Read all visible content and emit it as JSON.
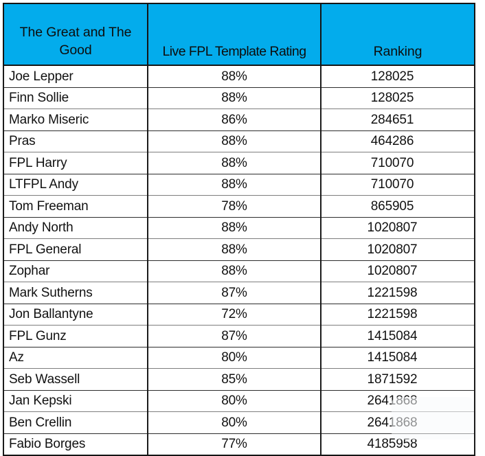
{
  "table": {
    "columns": [
      {
        "key": "name",
        "label": "The Great and The Good",
        "align": "left"
      },
      {
        "key": "rating",
        "label": "Live FPL Template Rating",
        "align": "center"
      },
      {
        "key": "rank",
        "label": "Ranking",
        "align": "center"
      }
    ],
    "header_background": "#03ACEC",
    "header_text_color": "#0d0d0d",
    "rows": [
      {
        "name": "Joe Lepper",
        "rating": "88%",
        "rank": "128025"
      },
      {
        "name": "Finn Sollie",
        "rating": "88%",
        "rank": "128025"
      },
      {
        "name": "Marko Miseric",
        "rating": "86%",
        "rank": "284651"
      },
      {
        "name": "Pras",
        "rating": "88%",
        "rank": "464286"
      },
      {
        "name": "FPL Harry",
        "rating": "88%",
        "rank": "710070"
      },
      {
        "name": "LTFPL Andy",
        "rating": "88%",
        "rank": "710070"
      },
      {
        "name": "Tom Freeman",
        "rating": "78%",
        "rank": "865905"
      },
      {
        "name": "Andy North",
        "rating": "88%",
        "rank": "1020807"
      },
      {
        "name": "FPL General",
        "rating": "88%",
        "rank": "1020807"
      },
      {
        "name": "Zophar",
        "rating": "88%",
        "rank": "1020807"
      },
      {
        "name": "Mark Sutherns",
        "rating": "87%",
        "rank": "1221598"
      },
      {
        "name": "Jon Ballantyne",
        "rating": "72%",
        "rank": "1221598"
      },
      {
        "name": "FPL Gunz",
        "rating": "87%",
        "rank": "1415084"
      },
      {
        "name": "Az",
        "rating": "80%",
        "rank": "1415084"
      },
      {
        "name": "Seb Wassell",
        "rating": "85%",
        "rank": "1871592"
      },
      {
        "name": "Jan Kepski",
        "rating": "80%",
        "rank": "2641868"
      },
      {
        "name": "Ben Crellin",
        "rating": "80%",
        "rank": "2641868"
      },
      {
        "name": "Fabio Borges",
        "rating": "77%",
        "rank": "4185958"
      }
    ]
  },
  "chart_data": {
    "type": "table",
    "title": "",
    "columns": [
      "The Great and The Good",
      "Live FPL Template Rating",
      "Ranking"
    ],
    "categories": [
      "Joe Lepper",
      "Finn Sollie",
      "Marko Miseric",
      "Pras",
      "FPL Harry",
      "LTFPL Andy",
      "Tom Freeman",
      "Andy North",
      "FPL General",
      "Zophar",
      "Mark Sutherns",
      "Jon Ballantyne",
      "FPL Gunz",
      "Az",
      "Seb Wassell",
      "Jan Kepski",
      "Ben Crellin",
      "Fabio Borges"
    ],
    "series": [
      {
        "name": "Live FPL Template Rating",
        "unit": "%",
        "values": [
          88,
          88,
          86,
          88,
          88,
          88,
          78,
          88,
          88,
          88,
          87,
          72,
          87,
          80,
          85,
          80,
          80,
          77
        ]
      },
      {
        "name": "Ranking",
        "unit": "",
        "values": [
          128025,
          128025,
          284651,
          464286,
          710070,
          710070,
          865905,
          1020807,
          1020807,
          1020807,
          1221598,
          1221598,
          1415084,
          1415084,
          1871592,
          2641868,
          2641868,
          4185958
        ]
      }
    ]
  }
}
